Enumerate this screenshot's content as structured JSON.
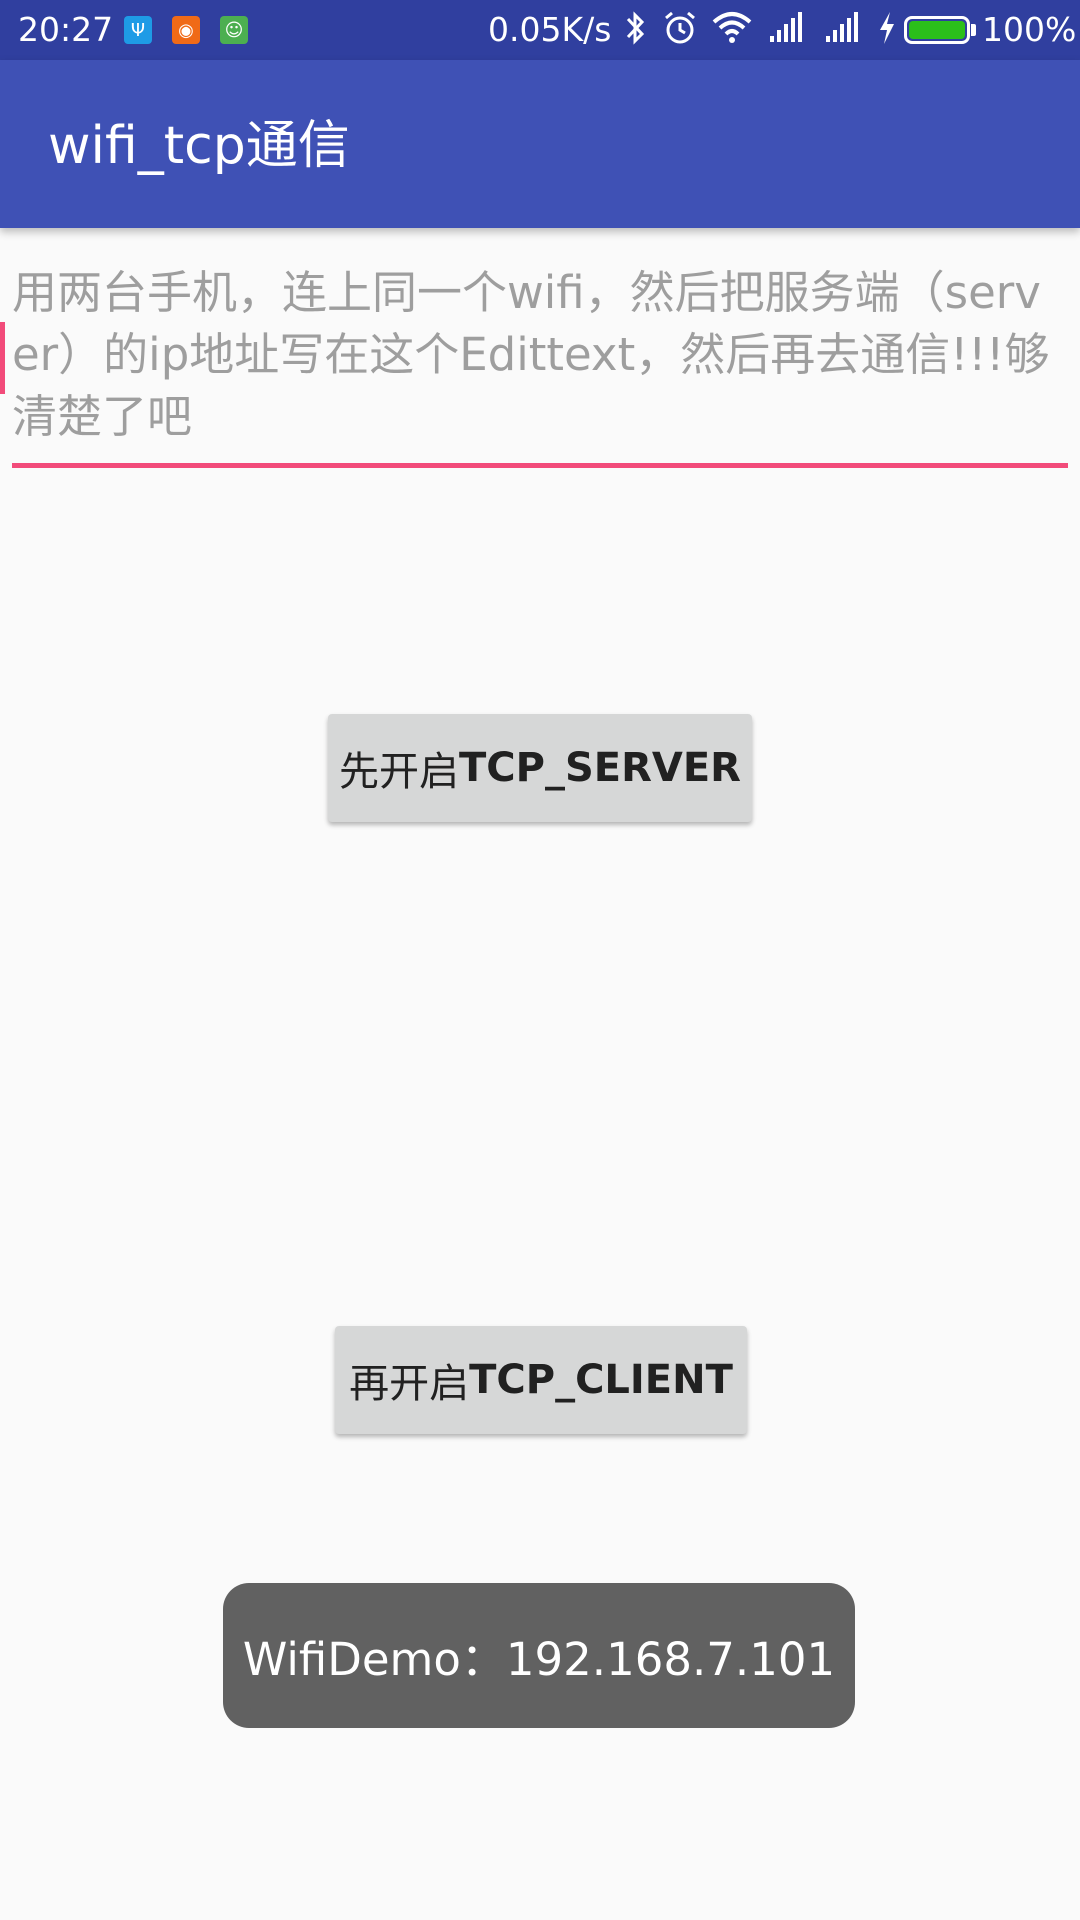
{
  "status_bar": {
    "time": "20:27",
    "net_speed": "0.05K/s",
    "battery_percent": "100%",
    "icons": [
      "usb-icon",
      "orange-app-icon",
      "android-debug-icon",
      "bluetooth-icon",
      "alarm-icon",
      "wifi-icon",
      "signal-icon",
      "signal-icon",
      "charging-icon",
      "battery-icon"
    ],
    "battery_level": 1.0,
    "background_color": "#303F9F"
  },
  "app_bar": {
    "title": "wifi_tcp通信",
    "background_color": "#3F51B5"
  },
  "edit_text": {
    "hint": "用两台手机，连上同一个wifi，然后把服务端（server）的ip地址写在这个Edittext，然后再去通信!!!够清楚了吧",
    "value": "",
    "accent_color": "#F24B7A"
  },
  "buttons": {
    "server_prefix": "先开启",
    "server_suffix": "TCP_SERVER",
    "client_prefix": "再开启",
    "client_suffix": "TCP_CLIENT"
  },
  "toast": {
    "text": "WifiDemo：192.168.7.101"
  }
}
